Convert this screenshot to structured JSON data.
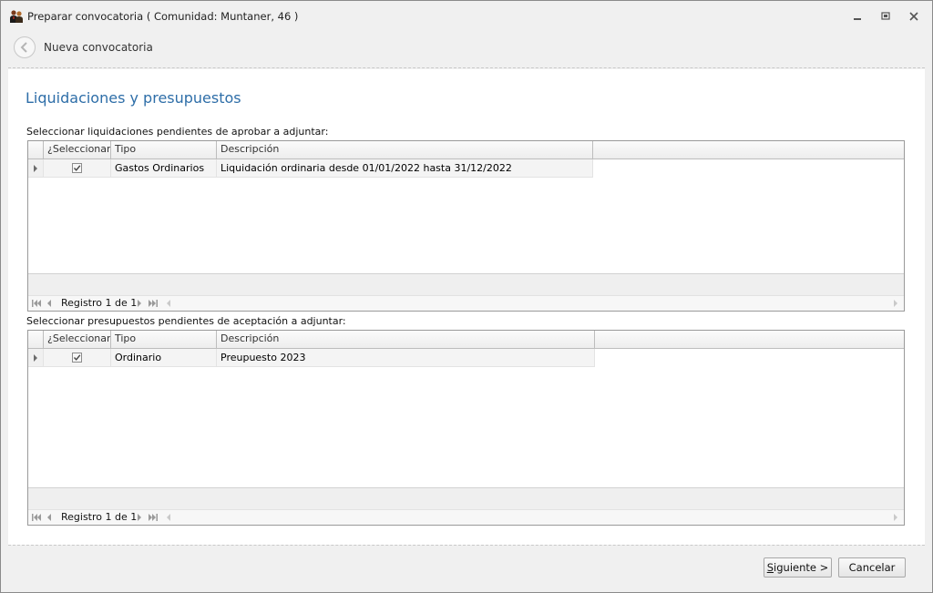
{
  "window": {
    "title": "Preparar convocatoria ( Comunidad: Muntaner, 46 )",
    "controls": [
      "minimize-icon",
      "restore-icon",
      "close-icon"
    ]
  },
  "wizard": {
    "title": "Nueva convocatoria",
    "page_title": "Liquidaciones y presupuestos"
  },
  "liquidaciones": {
    "label": "Seleccionar liquidaciones pendientes de aprobar a adjuntar:",
    "columns": [
      "¿Seleccionar?",
      "Tipo",
      "Descripción"
    ],
    "rows": [
      {
        "selected": true,
        "tipo": "Gastos Ordinarios",
        "descripcion": "Liquidación ordinaria desde 01/01/2022 hasta 31/12/2022"
      }
    ],
    "navigator": "Registro 1 de 1"
  },
  "presupuestos": {
    "label": "Seleccionar presupuestos pendientes de aceptación a adjuntar:",
    "columns": [
      "¿Seleccionar?",
      "Tipo",
      "Descripción"
    ],
    "rows": [
      {
        "selected": true,
        "tipo": "Ordinario",
        "descripcion": "Preupuesto 2023"
      }
    ],
    "navigator": "Registro 1 de 1"
  },
  "buttons": {
    "next": "Siguiente >",
    "next_hotkey": "S",
    "next_rest": "iguiente >",
    "cancel": "Cancelar"
  },
  "colors": {
    "accent": "#2e6ea8",
    "window_bg": "#f0f0f0"
  }
}
